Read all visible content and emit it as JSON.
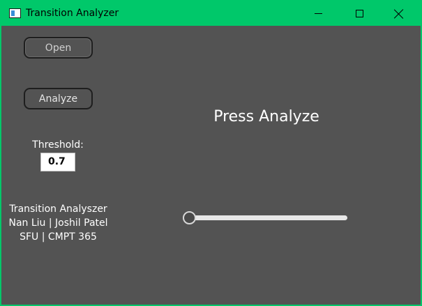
{
  "window": {
    "title": "Transition Analyzer",
    "icon": "app-window-icon",
    "accent_color": "#00c86a",
    "background_color": "#535353"
  },
  "controls": {
    "open_label": "Open",
    "analyze_label": "Analyze",
    "threshold_label": "Threshold:",
    "threshold_value": "0.7"
  },
  "credits": {
    "line1": "Transition Analyszer",
    "line2": "Nan Liu | Joshil Patel",
    "line3": "SFU | CMPT 365"
  },
  "status": {
    "message": "Press Analyze"
  },
  "slider": {
    "position": 0
  }
}
